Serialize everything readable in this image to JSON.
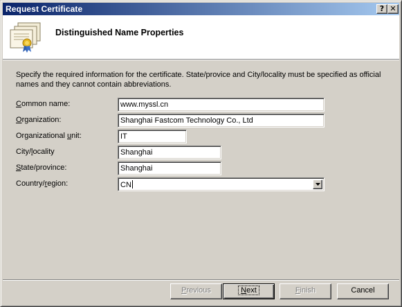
{
  "window": {
    "title": "Request Certificate",
    "help_glyph": "?",
    "close_glyph": "✕"
  },
  "header": {
    "title": "Distinguished Name Properties",
    "icon": "certificate-icon"
  },
  "description": "Specify the required information for the certificate. State/provice and City/locality must be specified as official names and they cannot contain abbreviations.",
  "form": {
    "common_name": {
      "label_underlined": "C",
      "label_rest": "ommon name:",
      "value": "www.myssl.cn"
    },
    "organization": {
      "label_underlined": "O",
      "label_rest": "rganization:",
      "value": "Shanghai Fastcom Technology Co., Ltd"
    },
    "org_unit": {
      "label_prefix": "Organizational ",
      "label_underlined": "u",
      "label_rest": "nit:",
      "value": "IT"
    },
    "city": {
      "label_prefix": "City/",
      "label_underlined": "l",
      "label_rest": "ocality",
      "value": "Shanghai"
    },
    "state": {
      "label_underlined": "S",
      "label_rest": "tate/province:",
      "value": "Shanghai"
    },
    "country": {
      "label_prefix": "Country/",
      "label_underlined": "r",
      "label_rest": "egion:",
      "value": "CN"
    }
  },
  "buttons": {
    "previous": {
      "underlined": "P",
      "rest": "revious",
      "enabled": false
    },
    "next": {
      "underlined": "N",
      "rest": "ext",
      "enabled": true
    },
    "finish": {
      "underlined": "F",
      "rest": "inish",
      "enabled": false
    },
    "cancel": {
      "label": "Cancel",
      "enabled": true
    }
  }
}
